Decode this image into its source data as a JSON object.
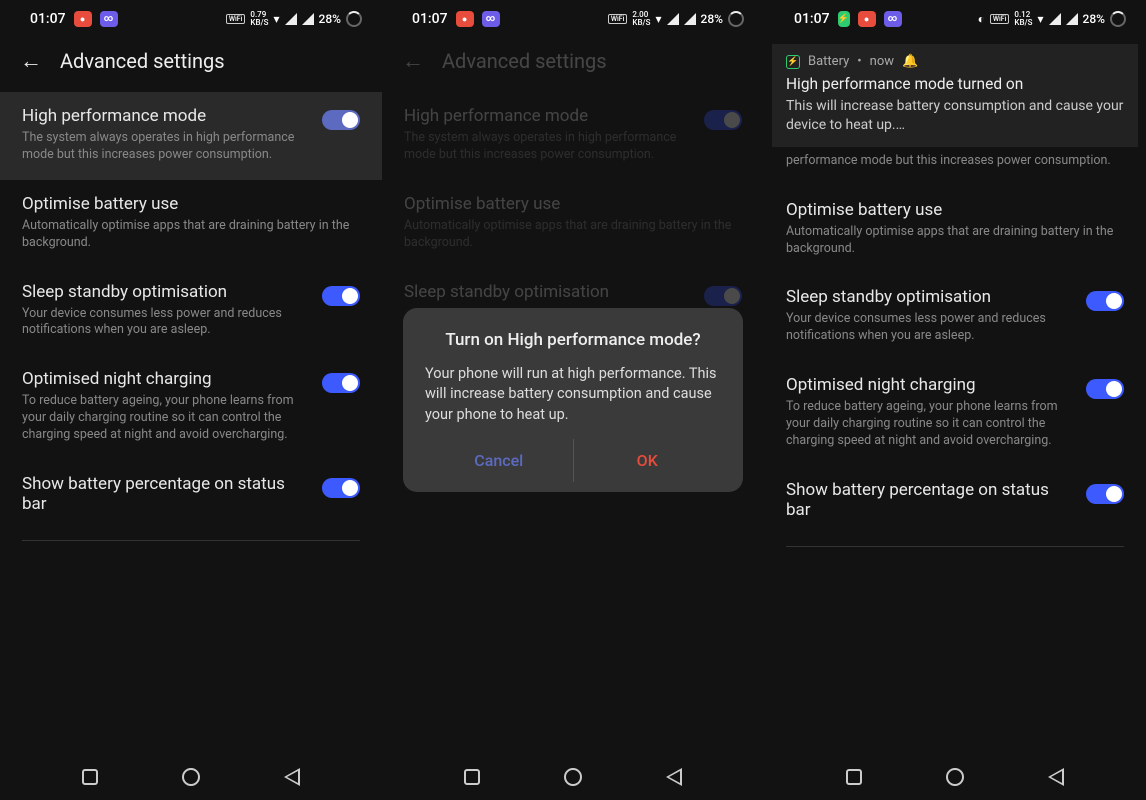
{
  "statusbar": {
    "time": "01:07",
    "battery_pct": "28%",
    "speed1": "0.79",
    "speed2": "2.00",
    "speed_unit": "KB/S",
    "wifi_label": "WiFi"
  },
  "header": {
    "title": "Advanced settings"
  },
  "settings": {
    "hpm": {
      "title": "High performance mode",
      "subtitle": "The system always operates in high performance mode but this increases power consumption."
    },
    "hpm_trunc_subtitle": "performance mode but this increases power consumption.",
    "optimise": {
      "title": "Optimise battery use",
      "subtitle": "Automatically optimise apps that are draining battery in the background."
    },
    "sleep": {
      "title": "Sleep standby optimisation",
      "subtitle": "Your device consumes less power and reduces notifications when you are asleep."
    },
    "night": {
      "title": "Optimised night charging",
      "subtitle": "To reduce battery ageing, your phone learns from your daily charging routine so it can control the charging speed at night and avoid overcharging."
    },
    "showpct": {
      "title": "Show battery percentage on status bar"
    }
  },
  "dialog": {
    "title": "Turn on High performance mode?",
    "body": "Your phone will run at high performance. This will increase battery consumption and cause your phone to heat up.",
    "cancel": "Cancel",
    "ok": "OK"
  },
  "notification": {
    "app": "Battery",
    "sep": "•",
    "time": "now",
    "title": "High performance mode turned on",
    "body": "This will increase battery consumption and cause your device to heat up.…"
  }
}
